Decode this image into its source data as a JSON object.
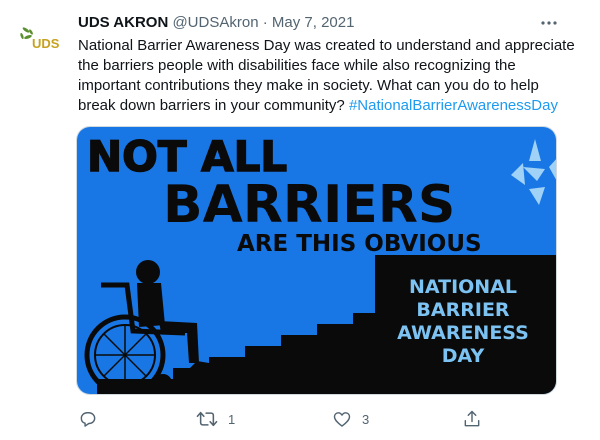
{
  "tweet": {
    "author_name": "UDS AKRON",
    "author_handle": "@UDSAkron",
    "separator": "·",
    "date": "May 7, 2021",
    "avatar_text": "UDS",
    "text_main": "National Barrier Awareness Day was created to understand and appreciate the barriers people with disabilities face while also recognizing the important contributions they make in society.  What can you do to help break down barriers in your community? ",
    "hashtag": "#NationalBarrierAwarenessDay"
  },
  "media": {
    "line1": "NOT ALL",
    "line2": "BARRIERS",
    "line3": "ARE THIS OBVIOUS",
    "caption_line1": "NATIONAL",
    "caption_line2": "BARRIER",
    "caption_line3": "AWARENESS",
    "caption_line4": "DAY",
    "colors": {
      "background": "#1877e5",
      "dark": "#0a0a0a",
      "caption": "#7cc3f3",
      "accent_light": "#9fd2f6"
    }
  },
  "actions": {
    "reply_icon": "reply-icon",
    "retweet_icon": "retweet-icon",
    "retweet_count": "1",
    "like_icon": "heart-icon",
    "like_count": "3",
    "share_icon": "share-icon"
  },
  "colors": {
    "hashtag": "#1d9bf0",
    "muted": "#536471",
    "avatar_leaf": "#5c8f2f",
    "avatar_text": "#c7a21e"
  }
}
